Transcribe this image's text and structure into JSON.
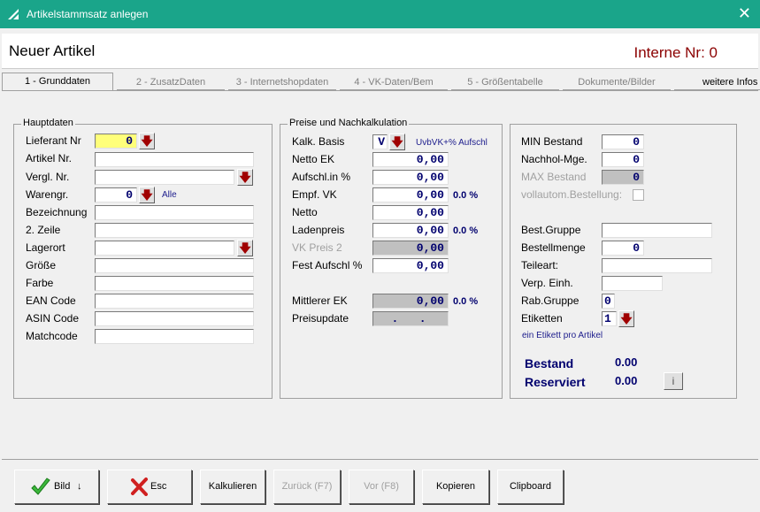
{
  "window": {
    "title": "Artikelstammsatz anlegen"
  },
  "header": {
    "title": "Neuer Artikel",
    "internal_nr": "Interne Nr: 0"
  },
  "tabs": [
    {
      "label": "1 - Grunddaten"
    },
    {
      "label": "2 - ZusatzDaten"
    },
    {
      "label": "3 - Internetshopdaten"
    },
    {
      "label": "4 - VK-Daten/Bem"
    },
    {
      "label": "5 - Größentabelle"
    },
    {
      "label": "Dokumente/Bilder"
    },
    {
      "label": "weitere Infos"
    }
  ],
  "hauptdaten": {
    "title": "Hauptdaten",
    "lieferant_label": "Lieferant Nr",
    "lieferant_value": "0",
    "artikel_label": "Artikel Nr.",
    "vergl_label": "Vergl. Nr.",
    "warengr_label": "Warengr.",
    "warengr_value": "0",
    "warengr_hint": "Alle",
    "bez_label": "Bezeichnung",
    "zeile2_label": "2. Zeile",
    "lagerort_label": "Lagerort",
    "groesse_label": "Größe",
    "farbe_label": "Farbe",
    "ean_label": "EAN Code",
    "asin_label": "ASIN Code",
    "match_label": "Matchcode"
  },
  "preise": {
    "title": "Preise und Nachkalkulation",
    "kalk_label": "Kalk. Basis",
    "kalk_value": "V",
    "kalk_hint": "UvbVK+% Aufschl",
    "netto_ek_label": "Netto EK",
    "netto_ek": "0,00",
    "aufschl_label": "Aufschl.in %",
    "aufschl": "0,00",
    "empf_label": "Empf. VK",
    "empf": "0,00",
    "empf_pct": "0.0 %",
    "netto_label": "Netto",
    "netto": "0,00",
    "laden_label": "Ladenpreis",
    "laden": "0,00",
    "laden_pct": "0.0 %",
    "vk2_label": "VK Preis 2",
    "vk2": "0,00",
    "fest_label": "Fest Aufschl %",
    "fest": "0,00",
    "mittlerer_label": "Mittlerer EK",
    "mittlerer": "0,00",
    "mittlerer_pct": "0.0 %",
    "update_label": "Preisupdate",
    "update_value": ".   ."
  },
  "bestand": {
    "min_label": "MIN Bestand",
    "min": "0",
    "nachhol_label": "Nachhol-Mge.",
    "nachhol": "0",
    "max_label": "MAX Bestand",
    "max": "0",
    "vollautom_label": "vollautom.Bestellung:",
    "bestgruppe_label": "Best.Gruppe",
    "bestmenge_label": "Bestellmenge",
    "bestmenge": "0",
    "teileart_label": "Teileart:",
    "verp_label": "Verp. Einh.",
    "rab_label": "Rab.Gruppe",
    "rab": "0",
    "etiketten_label": "Etiketten",
    "etiketten": "1",
    "etikett_hint": "ein Etikett pro Artikel",
    "bestand_label": "Bestand",
    "bestand_value": "0.00",
    "reserviert_label": "Reserviert",
    "reserviert_value": "0.00",
    "info_label": "i"
  },
  "buttons": {
    "bild": "Bild",
    "esc": "Esc",
    "kalkulieren": "Kalkulieren",
    "zurueck": "Zurück (F7)",
    "vor": "Vor (F8)",
    "kopieren": "Kopieren",
    "clipboard": "Clipboard"
  },
  "colors": {
    "titlebar": "#1aa58a",
    "value_blue": "#00006e",
    "internal_nr": "#8b0000",
    "lieferant_bg": "#ffff7a"
  }
}
